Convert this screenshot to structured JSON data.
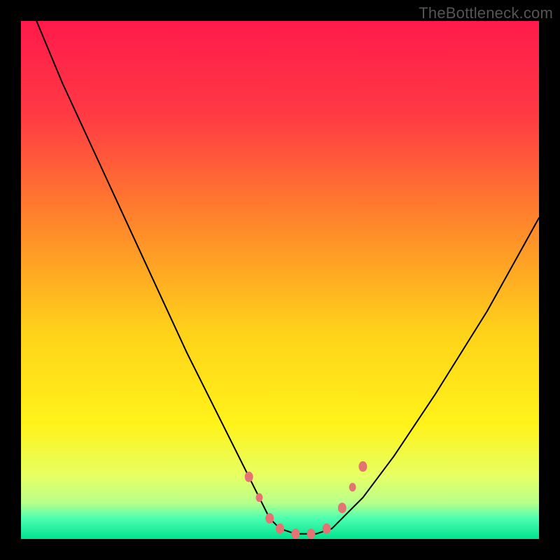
{
  "watermark": {
    "text": "TheBottleneck.com"
  },
  "chart_data": {
    "type": "line",
    "title": "",
    "xlabel": "",
    "ylabel": "",
    "xlim": [
      0,
      100
    ],
    "ylim": [
      0,
      100
    ],
    "axes_visible": false,
    "grid": false,
    "background_gradient_stops": [
      {
        "pos": 0.0,
        "color": "#ff1a4b"
      },
      {
        "pos": 0.18,
        "color": "#ff3a44"
      },
      {
        "pos": 0.4,
        "color": "#ff8a2a"
      },
      {
        "pos": 0.6,
        "color": "#ffd21a"
      },
      {
        "pos": 0.78,
        "color": "#fff31a"
      },
      {
        "pos": 0.88,
        "color": "#e6ff66"
      },
      {
        "pos": 0.93,
        "color": "#b8ff8a"
      },
      {
        "pos": 0.96,
        "color": "#4cffb0"
      },
      {
        "pos": 1.0,
        "color": "#00e38f"
      }
    ],
    "series": [
      {
        "name": "bottleneck-curve",
        "stroke": "#000000",
        "stroke_width": 2,
        "x": [
          3,
          8,
          14,
          20,
          26,
          32,
          38,
          43,
          46,
          48,
          50,
          53,
          57,
          60,
          62,
          66,
          72,
          80,
          90,
          100
        ],
        "y": [
          100,
          88,
          75,
          62,
          49,
          36,
          24,
          14,
          8,
          4,
          2,
          1,
          1,
          2,
          4,
          8,
          16,
          28,
          44,
          62
        ]
      }
    ],
    "markers": [
      {
        "name": "dot-left-1",
        "x": 44,
        "y": 12,
        "r": 6,
        "color": "#e57373"
      },
      {
        "name": "dot-left-2",
        "x": 46,
        "y": 8,
        "r": 5,
        "color": "#e57373"
      },
      {
        "name": "dot-left-3",
        "x": 48,
        "y": 4,
        "r": 6,
        "color": "#e57373"
      },
      {
        "name": "cap-left",
        "x": 50,
        "y": 2,
        "r": 6,
        "color": "#e57373"
      },
      {
        "name": "cap-mid-1",
        "x": 53,
        "y": 1,
        "r": 6,
        "color": "#e57373"
      },
      {
        "name": "cap-mid-2",
        "x": 56,
        "y": 1,
        "r": 6,
        "color": "#e57373"
      },
      {
        "name": "cap-right",
        "x": 59,
        "y": 2,
        "r": 6,
        "color": "#e57373"
      },
      {
        "name": "dot-right-1",
        "x": 62,
        "y": 6,
        "r": 6,
        "color": "#e57373"
      },
      {
        "name": "dot-right-2",
        "x": 64,
        "y": 10,
        "r": 5,
        "color": "#e57373"
      },
      {
        "name": "dot-right-3",
        "x": 66,
        "y": 14,
        "r": 6,
        "color": "#e57373"
      }
    ]
  }
}
